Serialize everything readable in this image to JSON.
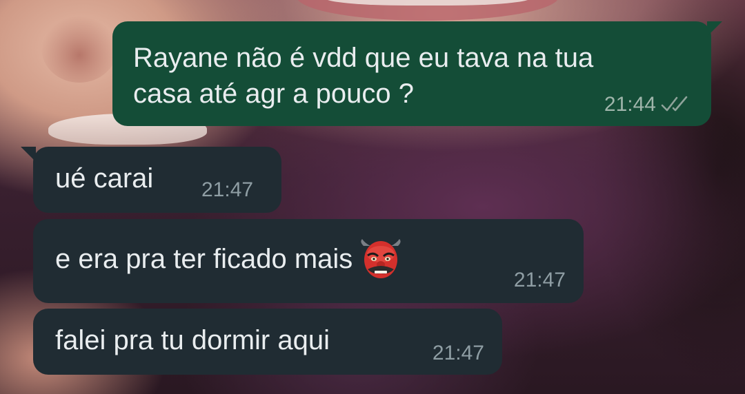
{
  "messages": [
    {
      "direction": "outgoing",
      "line1": "Rayane não é vdd que eu tava na tua",
      "line2": "casa até agr a pouco ?",
      "time": "21:44",
      "status_icon": "double-check-icon"
    },
    {
      "direction": "incoming",
      "text": "ué carai",
      "time": "21:47"
    },
    {
      "direction": "incoming",
      "text": "e era pra ter ficado mais",
      "emoji": "goblin-mask-emoji",
      "time": "21:47"
    },
    {
      "direction": "incoming",
      "text": "falei pra tu dormir aqui",
      "time": "21:47"
    }
  ],
  "colors": {
    "outgoing_bubble": "#144d37",
    "incoming_bubble": "#202c33",
    "text": "#e9edef",
    "timestamp": "#8f9ea4"
  }
}
